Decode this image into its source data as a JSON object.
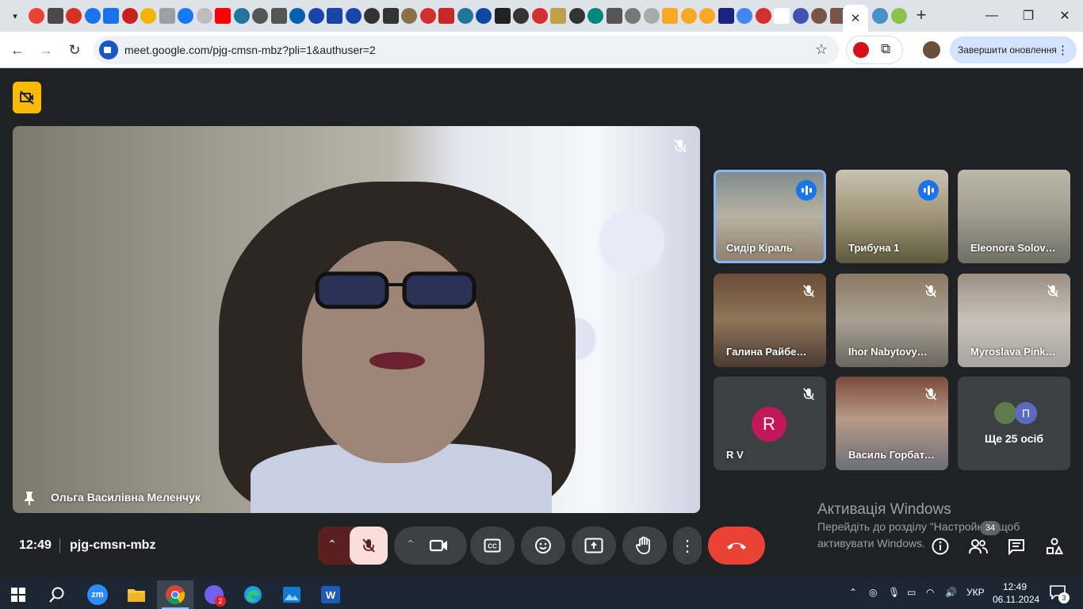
{
  "browser": {
    "url": "meet.google.com/pjg-cmsn-mbz?pli=1&authuser=2",
    "update_button_label": "Завершити оновлення",
    "tab_close": "✕",
    "new_tab": "+",
    "favicon_colors": [
      "#ea4335",
      "#4a4a4a",
      "#d93025",
      "#1a73e8",
      "#1a73e8",
      "#c5221f",
      "#f4b400",
      "#9aa0a6",
      "#1877f2",
      "#bdbdbd",
      "#ff0000",
      "#21759b",
      "#555",
      "#555",
      "#0061b0",
      "#1a45a8",
      "#1a45a8",
      "#1a45a8",
      "#333",
      "#333",
      "#8b6f47",
      "#d32f2f",
      "#c62828",
      "#21759b",
      "#0d47a1",
      "#222",
      "#333",
      "#d32f2f",
      "#bfa14a",
      "#333",
      "#00897b",
      "#555",
      "#777",
      "#aaa",
      "#f9a825",
      "#f9a825",
      "#f9a825",
      "#1a237e",
      "#4285f4",
      "#d32f2f",
      "#fff",
      "#3f51b5",
      "#795548",
      "#795548"
    ]
  },
  "meet": {
    "main": {
      "name": "Ольга Василівна Меленчук"
    },
    "tiles": [
      {
        "name": "Сидір Кіраль",
        "state": "speaking",
        "active": true
      },
      {
        "name": "Трибуна 1",
        "state": "speaking",
        "active": false
      },
      {
        "name": "Eleonora Solov…",
        "state": "none",
        "active": false
      },
      {
        "name": "Галина Райбе…",
        "state": "muted",
        "active": false
      },
      {
        "name": "Ihor Nabytovy…",
        "state": "muted",
        "active": false
      },
      {
        "name": "Myroslava Pink…",
        "state": "muted",
        "active": false
      },
      {
        "name": "R V",
        "state": "muted",
        "active": false,
        "avatar_letter": "R"
      },
      {
        "name": "Василь Горбат…",
        "state": "muted",
        "active": false
      }
    ],
    "more": {
      "label": "Ще 25 осіб",
      "avatar_letter": "П"
    },
    "clock": "12:49",
    "meeting_code": "pjg-cmsn-mbz",
    "participants_count": "34",
    "colors": {
      "end_call": "#ea4335",
      "mic_off_bg": "#f9dedc",
      "active_ring": "#8ab4f8",
      "speaking": "#1a73e8",
      "badge": "#f9ba00"
    }
  },
  "watermark": {
    "title": "Активація Windows",
    "line1": "Перейдіть до розділу \"Настройки\", щоб",
    "line2": "активувати Windows."
  },
  "taskbar": {
    "language": "УКР",
    "time": "12:49",
    "date": "06.11.2024",
    "viber_badge": "2",
    "notifications": "3",
    "zoom_label": "zm"
  }
}
